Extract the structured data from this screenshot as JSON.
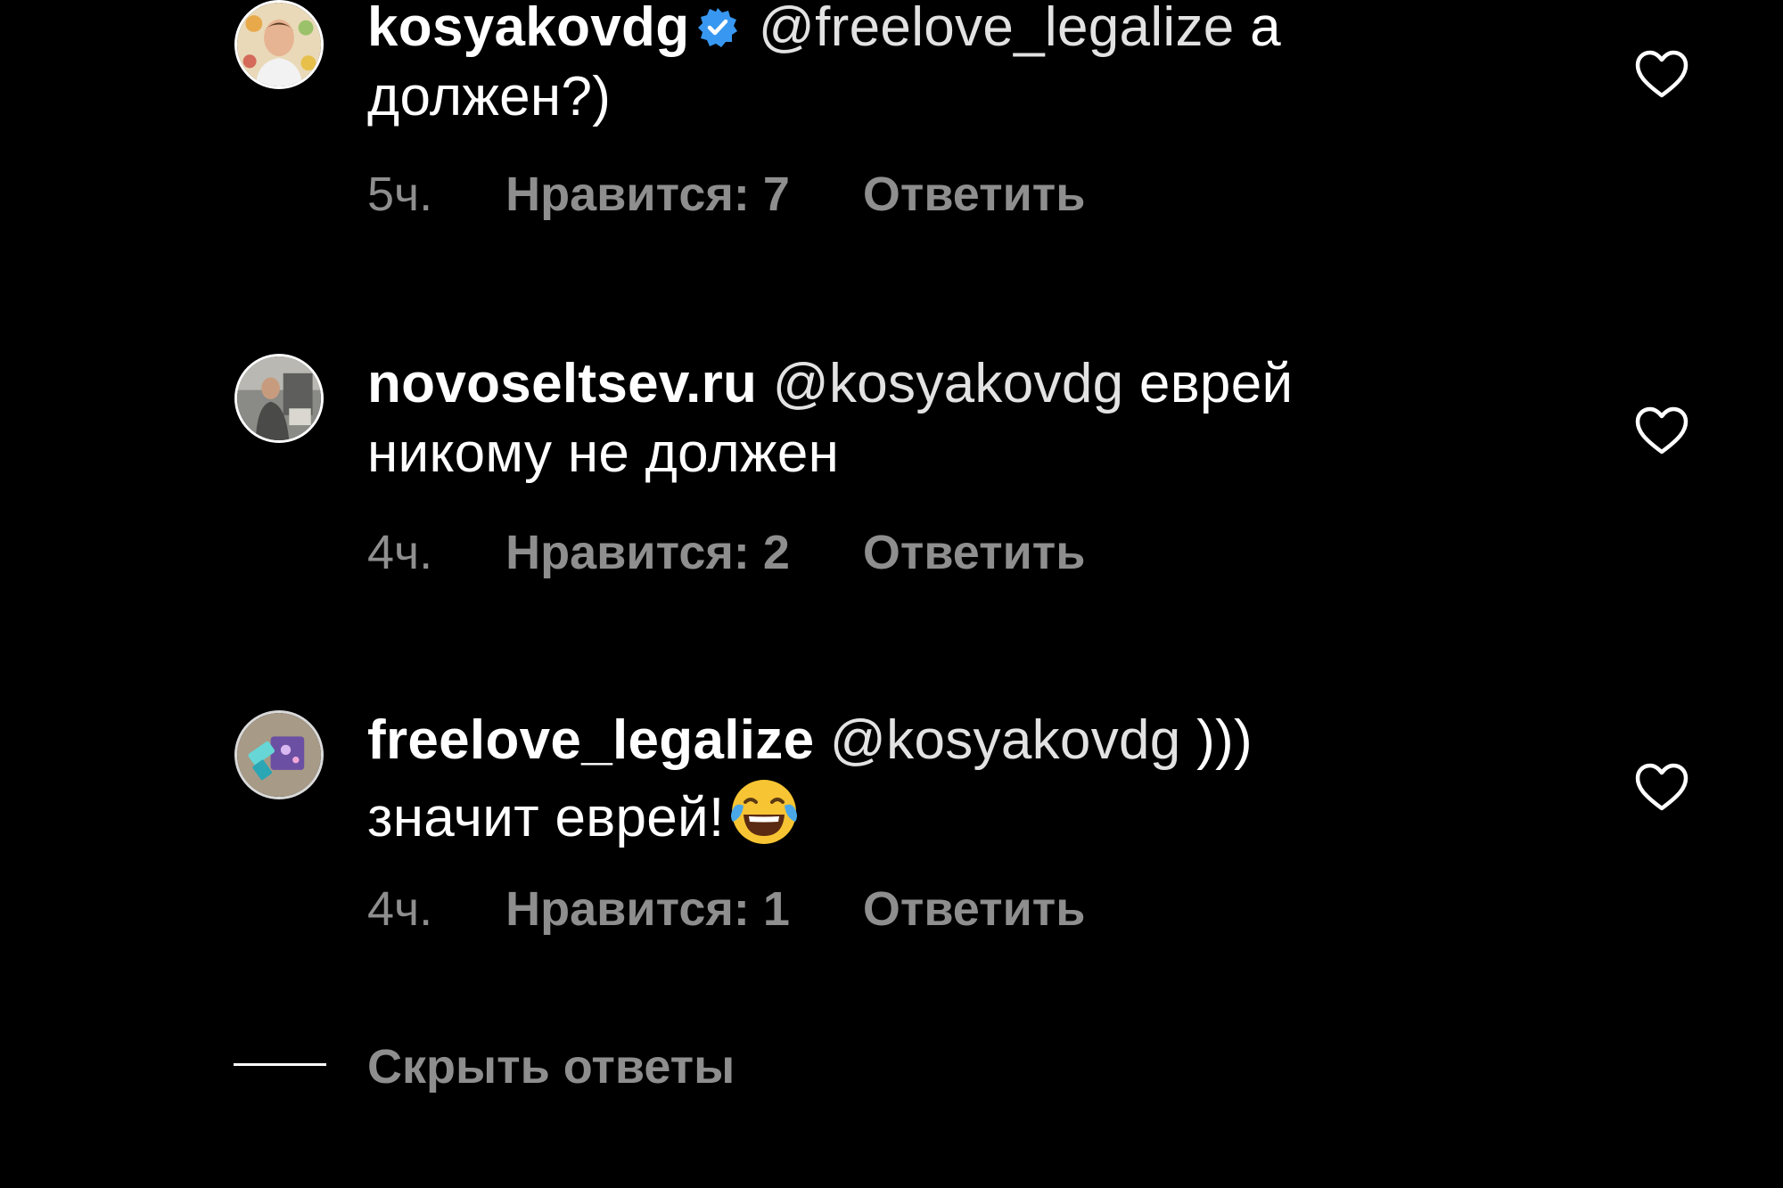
{
  "comments": [
    {
      "username": "kosyakovdg",
      "verified": true,
      "mention": "@freelove_legalize",
      "text_line1_tail": " а",
      "text_line2": "должен?)",
      "time": "5ч.",
      "likes": "Нравится: 7",
      "reply": "Ответить",
      "avatar_icon": "person-photo-avatar"
    },
    {
      "username": "novoseltsev.ru",
      "verified": false,
      "mention": "@kosyakovdg",
      "text_line1_tail": " еврей",
      "text_line2": "никому не должен",
      "time": "4ч.",
      "likes": "Нравится: 2",
      "reply": "Ответить",
      "avatar_icon": "person-photo-avatar"
    },
    {
      "username": "freelove_legalize",
      "verified": false,
      "mention": "@kosyakovdg",
      "text_line1_tail": " )))",
      "text_line2": "значит еврей!",
      "emoji": "face-with-tears-of-joy",
      "time": "4ч.",
      "likes": "Нравится: 1",
      "reply": "Ответить",
      "avatar_icon": "illustration-avatar"
    }
  ],
  "hide_replies": "Скрыть ответы",
  "colors": {
    "background": "#000000",
    "text": "#ffffff",
    "secondary": "#8e8e8e",
    "verified": "#3897f0"
  },
  "icons": {
    "like": "heart-outline-icon",
    "verified": "verified-badge-icon"
  }
}
